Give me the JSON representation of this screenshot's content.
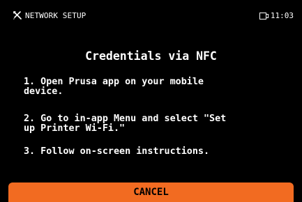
{
  "header": {
    "icon": "wrench-screwdriver-icon",
    "title": "NETWORK SETUP",
    "storage_icon": "usb-drive-icon",
    "time": "11:03"
  },
  "content": {
    "title": "Credentials via NFC",
    "steps": [
      "1. Open Prusa app on your mobile\ndevice.",
      "2. Go to in-app Menu and select \"Set\nup Printer Wi-Fi.\"",
      "3. Follow on-screen instructions."
    ]
  },
  "actions": {
    "cancel_label": "CANCEL"
  },
  "colors": {
    "background": "#000000",
    "text": "#ffffff",
    "accent": "#f26b21",
    "button_text": "#000000"
  }
}
